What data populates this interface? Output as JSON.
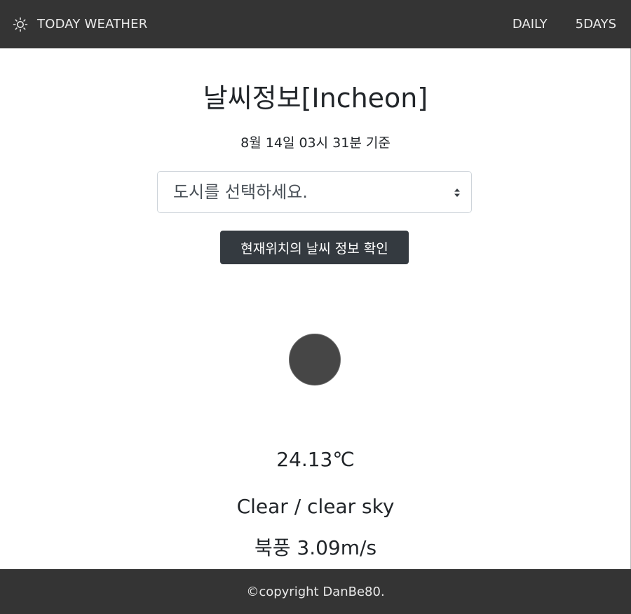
{
  "navbar": {
    "brand_icon": "sun-icon",
    "brand_label": "TODAY WEATHER",
    "links": [
      {
        "label": "DAILY"
      },
      {
        "label": "5DAYS"
      }
    ]
  },
  "main": {
    "title": "날씨정보[Incheon]",
    "timestamp": "8월 14일 03시 31분 기준",
    "city_select": {
      "selected": "도시를 선택하세요."
    },
    "location_button_label": "현재위치의 날씨 정보 확인",
    "weather_icon": "weather-icon-circle",
    "temperature": "24.13℃",
    "description": "Clear / clear sky",
    "wind": "북풍 3.09m/s"
  },
  "footer": {
    "copyright": "©copyright DanBe80."
  },
  "colors": {
    "navbar_bg": "#343434",
    "button_bg": "#343a40",
    "icon_fill": "#464646"
  }
}
